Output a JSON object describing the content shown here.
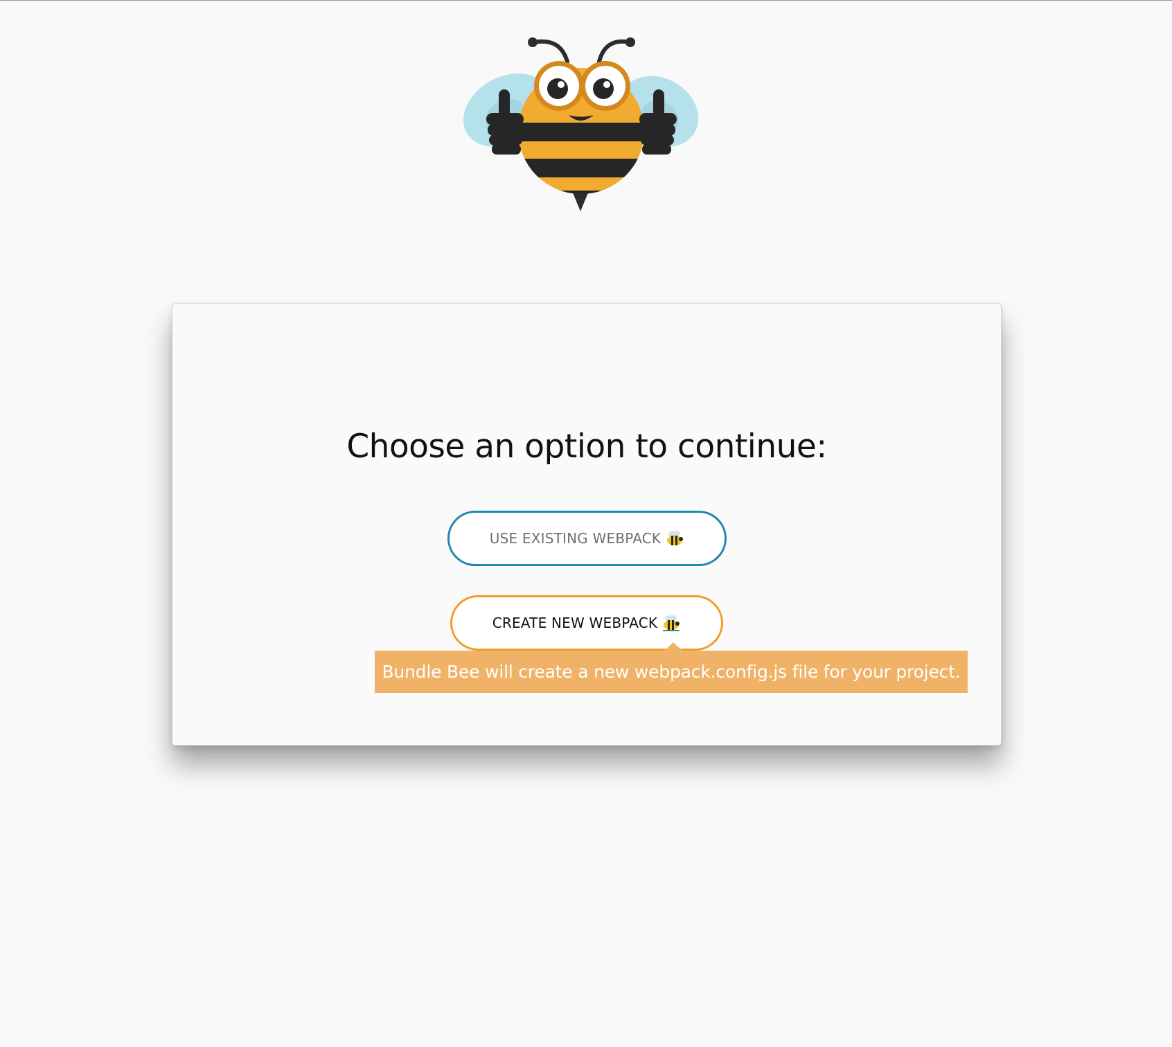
{
  "mascot": {
    "icon": "bee-mascot-logo"
  },
  "card": {
    "title": "Choose an option to continue:",
    "buttons": [
      {
        "label": "USE EXISTING WEBPACK",
        "icon": "bee-emoji-icon",
        "border_color": "#1f87b4"
      },
      {
        "label": "CREATE NEW WEBPACK",
        "icon": "bee-emoji-icon",
        "border_color": "#f39c2a"
      }
    ],
    "tooltip": {
      "text": "Bundle Bee will create a new webpack.config.js file for your project.",
      "background": "#f0b266"
    }
  },
  "colors": {
    "background": "#f9f9f9",
    "bee_body": "#f1ab30",
    "bee_stripe": "#262626",
    "wing": "#b4e1ea"
  }
}
